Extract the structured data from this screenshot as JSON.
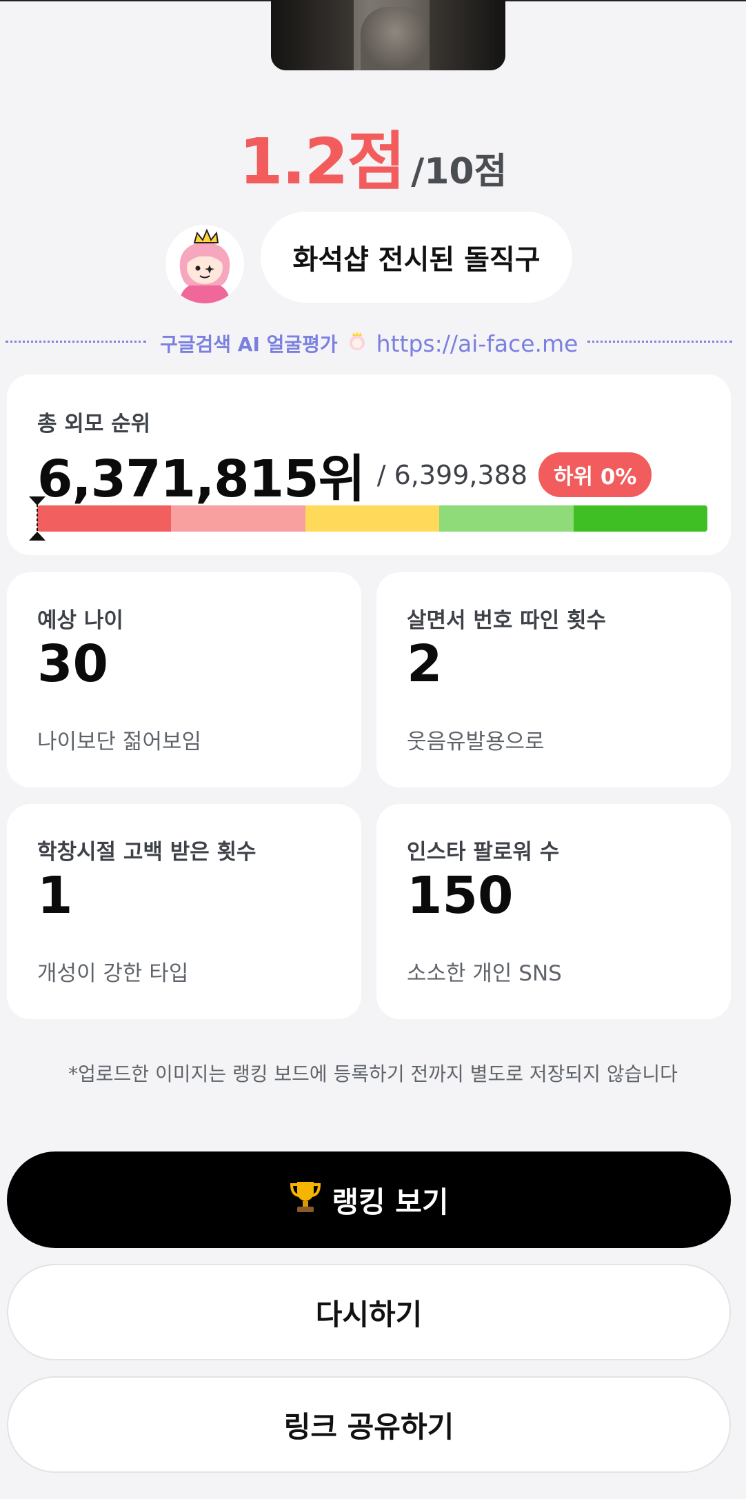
{
  "result": {
    "score": "1.2점",
    "score_total": "/10점",
    "comment": "화석샵 전시된 돌직구"
  },
  "promo": {
    "text": "구글검색 AI 얼굴평가",
    "url": "https://ai-face.me"
  },
  "ranking": {
    "label": "총 외모 순위",
    "rank": "6,371,815위",
    "total": "/ 6,399,388",
    "badge": "하위 0%",
    "percentile_from_bottom": 0,
    "bar_colors": [
      "#f25f5f",
      "#f7a09f",
      "#ffd95a",
      "#8fdb79",
      "#3fbf23"
    ]
  },
  "stats": [
    {
      "label": "예상 나이",
      "value": "30",
      "note": "나이보단 젊어보임"
    },
    {
      "label": "살면서 번호 따인 횟수",
      "value": "2",
      "note": "웃음유발용으로"
    },
    {
      "label": "학창시절 고백 받은 횟수",
      "value": "1",
      "note": "개성이 강한 타입"
    },
    {
      "label": "인스타 팔로워 수",
      "value": "150",
      "note": "소소한 개인 SNS"
    }
  ],
  "disclaimer": "*업로드한 이미지는 랭킹 보드에 등록하기 전까지 별도로 저장되지 않습니다",
  "buttons": {
    "ranking": "랭킹 보기",
    "retry": "다시하기",
    "share": "링크 공유하기"
  },
  "icons": {
    "trophy": "trophy-icon",
    "mascot": "princess-mascot-icon"
  },
  "colors": {
    "accent_red": "#f25c5c",
    "promo_blue": "#7a7fe0",
    "primary_button": "#000000"
  }
}
